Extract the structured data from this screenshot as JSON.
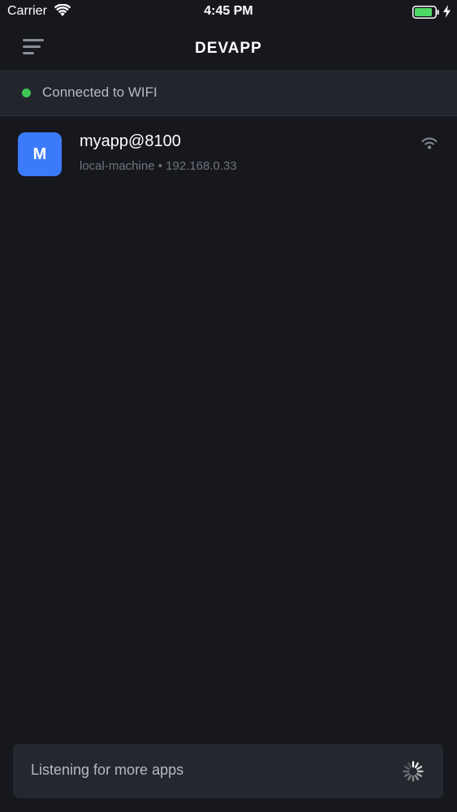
{
  "status_bar": {
    "carrier": "Carrier",
    "time": "4:45 PM",
    "wifi_icon": "wifi-icon",
    "battery_icon": "battery-icon",
    "charging_icon": "charging-bolt-icon"
  },
  "nav": {
    "menu_icon": "hamburger-menu-icon",
    "brand": "DEVAPP"
  },
  "connection": {
    "text": "Connected to WIFI",
    "status_color": "#3ec654"
  },
  "apps": [
    {
      "avatar_letter": "M",
      "avatar_color": "#3b7bfb",
      "name": "myapp@8100",
      "host": "local-machine",
      "ip": "192.168.0.33",
      "subtitle": "local-machine • 192.168.0.33",
      "signal_icon": "wifi-signal-icon"
    }
  ],
  "footer": {
    "text": "Listening for more apps",
    "spinner_icon": "loading-spinner-icon"
  },
  "colors": {
    "background": "#17181d",
    "banner": "#23252c",
    "card": "#25272e",
    "accent": "#3b7bfb"
  }
}
